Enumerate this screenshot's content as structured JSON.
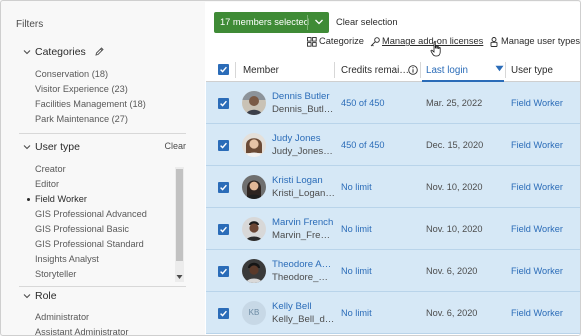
{
  "filters": {
    "title": "Filters",
    "categories": {
      "label": "Categories",
      "items": [
        {
          "label": "Conservation",
          "count": "(18)"
        },
        {
          "label": "Visitor Experience",
          "count": "(23)"
        },
        {
          "label": "Facilities Management",
          "count": "(18)"
        },
        {
          "label": "Park Maintenance",
          "count": "(27)"
        }
      ]
    },
    "user_type": {
      "label": "User type",
      "clear": "Clear",
      "items": [
        "Creator",
        "Editor",
        "Field Worker",
        "GIS Professional Advanced",
        "GIS Professional Basic",
        "GIS Professional Standard",
        "Insights Analyst",
        "Storyteller"
      ],
      "selected": "Field Worker"
    },
    "role": {
      "label": "Role",
      "items": [
        "Administrator",
        "Assistant Administrator"
      ]
    }
  },
  "toolbar": {
    "selection_label": "17 members selected",
    "clear_selection": "Clear selection",
    "categorize": "Categorize",
    "manage_addon": "Manage add-on licenses",
    "manage_user_types": "Manage user types"
  },
  "table": {
    "columns": {
      "member": "Member",
      "credits": "Credits remai…",
      "last_login": "Last login",
      "user_type": "User type"
    },
    "rows": [
      {
        "name": "Dennis Butler",
        "username": "Dennis_Butl…",
        "credits": "450 of 450",
        "last_login": "Mar. 25, 2022",
        "user_type": "Field Worker",
        "avatar": "photo"
      },
      {
        "name": "Judy Jones",
        "username": "Judy_Jones…",
        "credits": "450 of 450",
        "last_login": "Dec. 15, 2020",
        "user_type": "Field Worker",
        "avatar": "photo"
      },
      {
        "name": "Kristi Logan",
        "username": "Kristi_Logan…",
        "credits": "No limit",
        "last_login": "Nov. 10, 2020",
        "user_type": "Field Worker",
        "avatar": "photo"
      },
      {
        "name": "Marvin French",
        "username": "Marvin_Fre…",
        "credits": "No limit",
        "last_login": "Nov. 10, 2020",
        "user_type": "Field Worker",
        "avatar": "photo"
      },
      {
        "name": "Theodore A…",
        "username": "Theodore_…",
        "credits": "No limit",
        "last_login": "Nov. 6, 2020",
        "user_type": "Field Worker",
        "avatar": "photo"
      },
      {
        "name": "Kelly Bell",
        "username": "Kelly_Bell_d…",
        "credits": "No limit",
        "last_login": "Nov. 6, 2020",
        "user_type": "Field Worker",
        "avatar": "KB"
      }
    ]
  },
  "colors": {
    "accent": "#2b6cb8",
    "selection_button": "#3f8b36",
    "selected_row": "#d6e8f6"
  }
}
